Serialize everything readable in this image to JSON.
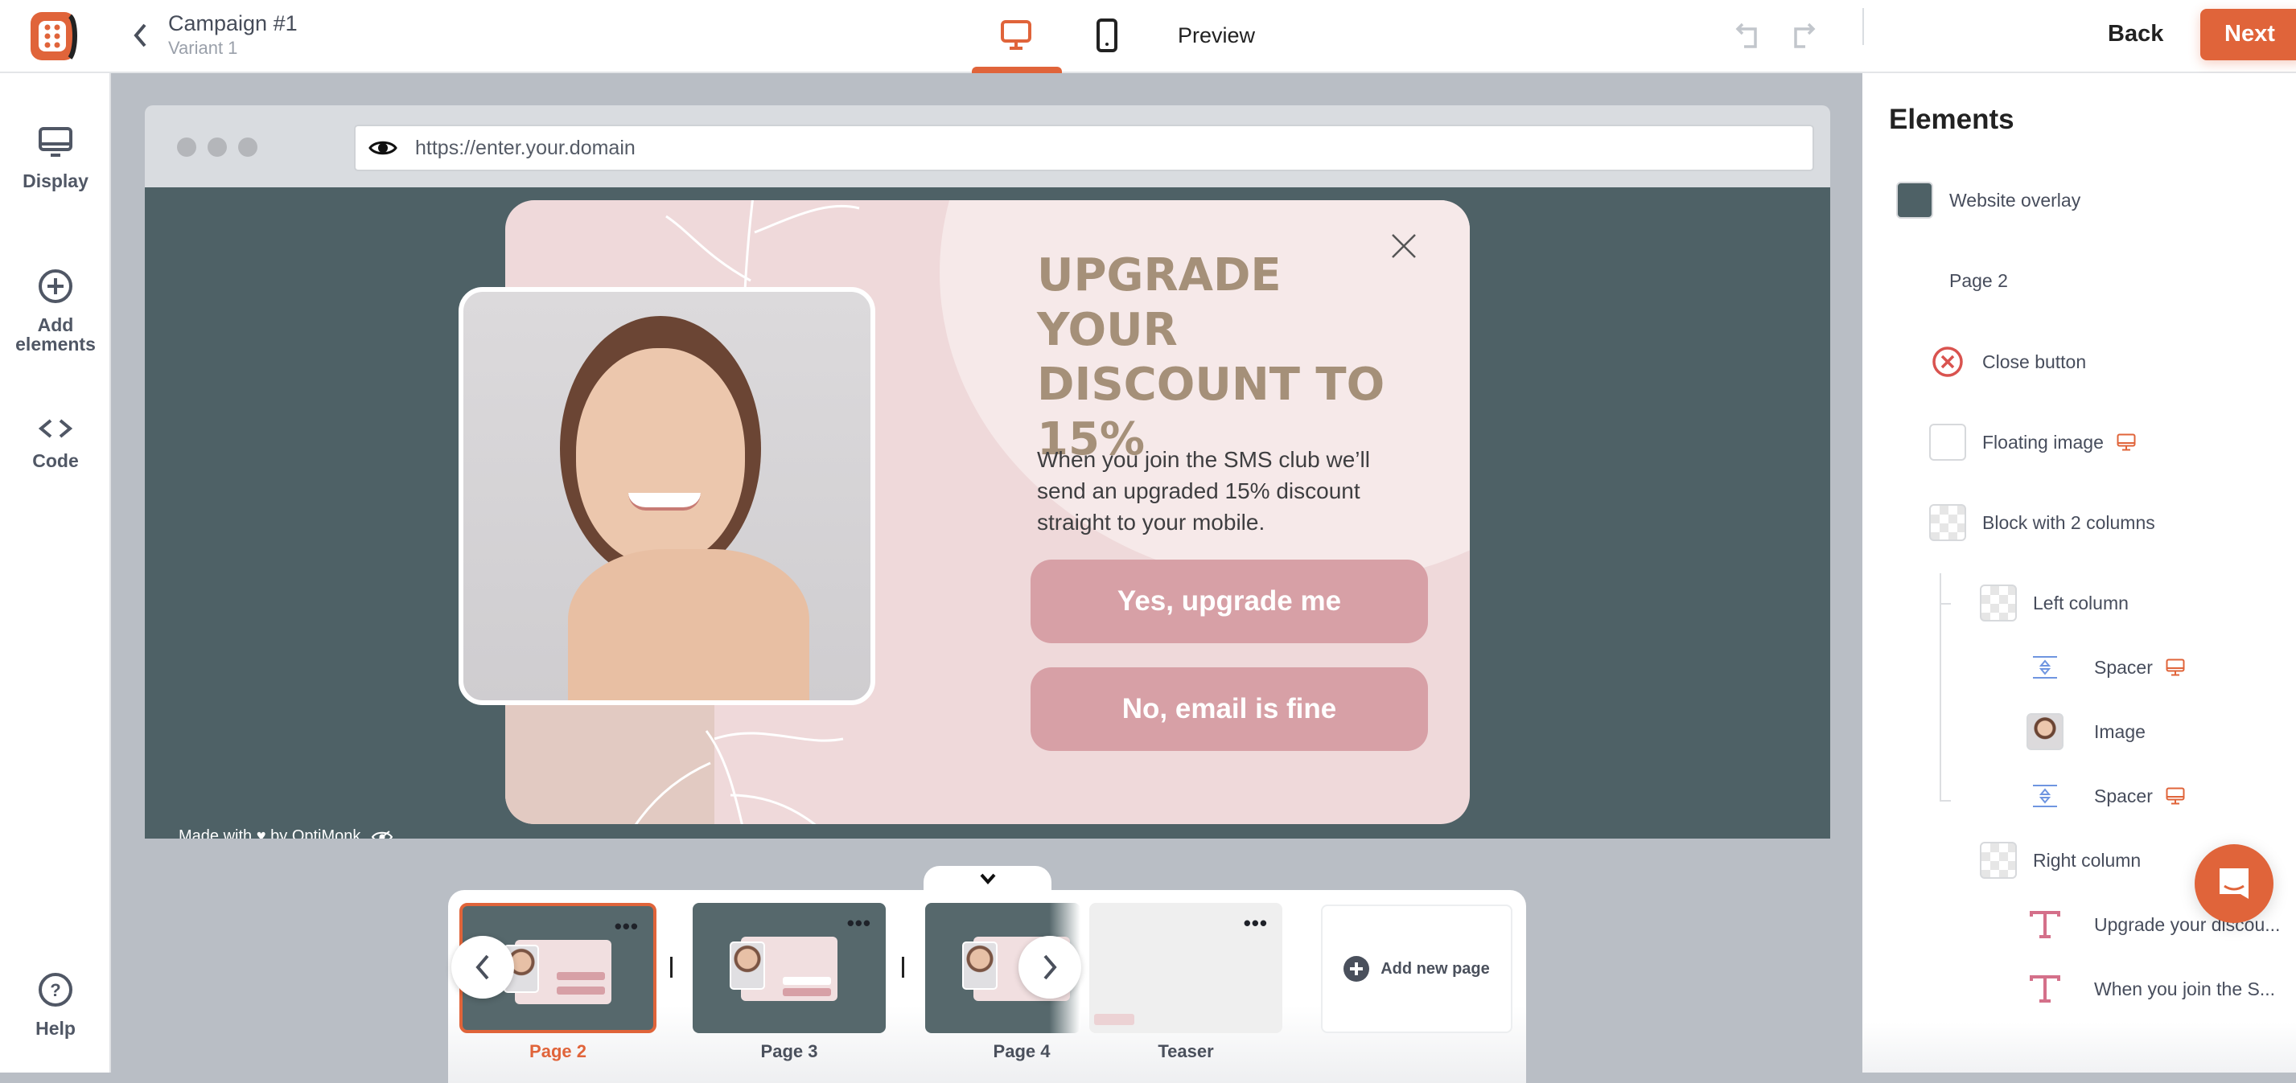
{
  "header": {
    "campaign_title": "Campaign #1",
    "variant": "Variant 1",
    "preview_label": "Preview",
    "back_label": "Back",
    "next_label": "Next",
    "accent": "#e0643a"
  },
  "sidebar": {
    "items": [
      {
        "label": "Display",
        "icon": "monitor-icon"
      },
      {
        "label": "Add elements",
        "icon": "plus-circle-icon"
      },
      {
        "label": "Code",
        "icon": "code-icon"
      }
    ],
    "help": {
      "label": "Help",
      "icon": "help-icon"
    }
  },
  "browser": {
    "url": "https://enter.your.domain"
  },
  "popup": {
    "heading": "UPGRADE YOUR DISCOUNT TO 15%",
    "body": "When you join the SMS club we’ll send an upgraded 15% discount straight to your mobile.",
    "primary_button": "Yes, upgrade me",
    "secondary_button": "No, email is fine",
    "made_with": "Made with ♥ by OptiMonk",
    "overlay_color": "#4e6166",
    "heading_color": "#a59079",
    "button_color": "#d7a0a6"
  },
  "pages": {
    "items": [
      {
        "label": "Page 2",
        "active": true
      },
      {
        "label": "Page 3",
        "active": false
      },
      {
        "label": "Page 4",
        "active": false
      },
      {
        "label": "Teaser",
        "active": false
      }
    ],
    "add_label": "Add new page"
  },
  "elements": {
    "title": "Elements",
    "items": [
      {
        "label": "Website overlay",
        "icon": "overlay-swatch"
      },
      {
        "label": "Page 2",
        "icon": ""
      },
      {
        "label": "Close button",
        "icon": "close-circle-icon"
      },
      {
        "label": "Floating image",
        "icon": "blank-swatch",
        "desktop_only": true
      },
      {
        "label": "Block with 2 columns",
        "icon": "checker-swatch"
      },
      {
        "label": "Left column",
        "icon": "checker-swatch"
      },
      {
        "label": "Spacer",
        "icon": "spacer-icon",
        "desktop_only": true
      },
      {
        "label": "Image",
        "icon": "image-thumbnail"
      },
      {
        "label": "Spacer",
        "icon": "spacer-icon",
        "desktop_only": true
      },
      {
        "label": "Right column",
        "icon": "checker-swatch"
      },
      {
        "label": "Upgrade your discou...",
        "icon": "text-icon"
      },
      {
        "label": "When you join the S...",
        "icon": "text-icon"
      }
    ]
  }
}
